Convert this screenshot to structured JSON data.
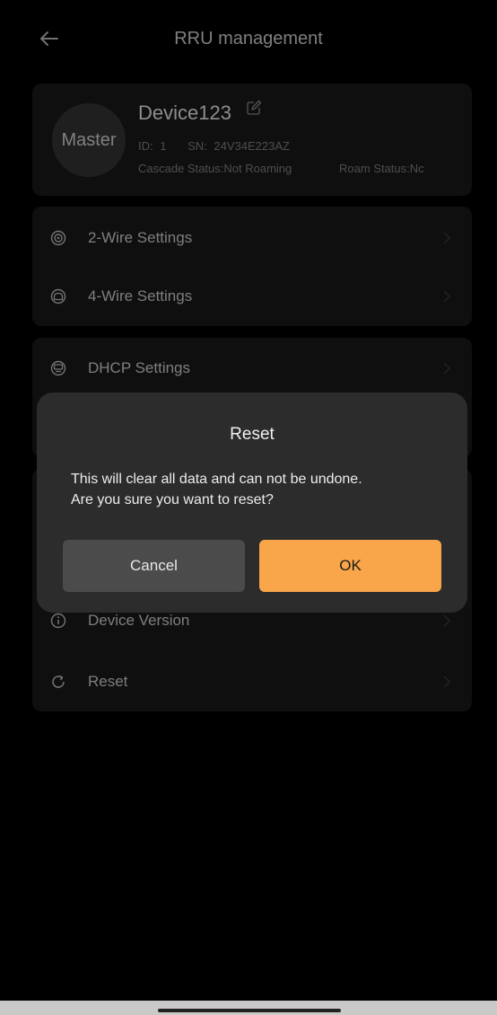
{
  "header": {
    "title": "RRU management",
    "back_icon": "arrow-left-icon"
  },
  "device": {
    "role": "Master",
    "name": "Device123",
    "id_label": "ID:",
    "id_value": "1",
    "sn_label": "SN:",
    "sn_value": "24V34E223AZ",
    "cascade_status": "Cascade Status:Not Roaming",
    "roam_status": "Roam Status:Nc"
  },
  "menu": {
    "group1": [
      {
        "label": "2-Wire Settings",
        "icon": "two-wire-icon"
      },
      {
        "label": "4-Wire Settings",
        "icon": "four-wire-icon"
      }
    ],
    "group2": [
      {
        "label": "DHCP Settings",
        "icon": "dhcp-icon"
      }
    ],
    "group3": [
      {
        "label": "Device Version",
        "icon": "info-icon"
      },
      {
        "label": "Reset",
        "icon": "reset-icon"
      }
    ]
  },
  "dialog": {
    "title": "Reset",
    "message": "This will clear all data and can not be undone.\nAre you sure you want to reset?",
    "cancel_label": "Cancel",
    "ok_label": "OK"
  },
  "colors": {
    "accent": "#f9a54a",
    "card": "#1c1c1c",
    "dialog": "#2c2c2c",
    "background": "#000000"
  }
}
